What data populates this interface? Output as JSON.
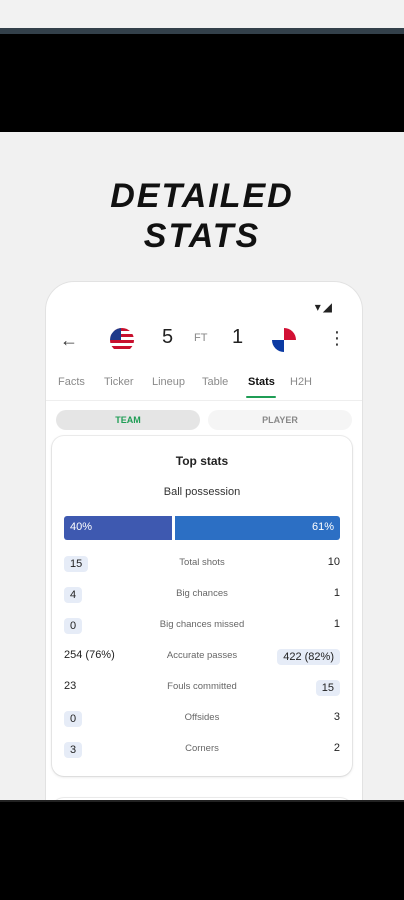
{
  "poster": {
    "headline_line1": "DETAILED",
    "headline_line2": "STATS"
  },
  "statusbar": {
    "wifi_icon": "wifi-icon",
    "signal_icon": "signal-icon"
  },
  "match": {
    "home_score": "5",
    "status": "FT",
    "away_score": "1"
  },
  "tabs": [
    "Facts",
    "Ticker",
    "Lineup",
    "Table",
    "Stats",
    "H2H"
  ],
  "active_tab": "Stats",
  "toggle": {
    "team": "TEAM",
    "player": "PLAYER"
  },
  "top_stats": {
    "title": "Top stats",
    "possession_label": "Ball possession",
    "possession_home": "40%",
    "possession_away": "61%",
    "rows": [
      {
        "left": "15",
        "label": "Total shots",
        "right": "10"
      },
      {
        "left": "4",
        "label": "Big chances",
        "right": "1"
      },
      {
        "left": "0",
        "label": "Big chances missed",
        "right": "1"
      },
      {
        "left": "254 (76%)",
        "label": "Accurate passes",
        "right": "422 (82%)"
      },
      {
        "left": "23",
        "label": "Fouls committed",
        "right": "15"
      },
      {
        "left": "0",
        "label": "Offsides",
        "right": "3"
      },
      {
        "left": "3",
        "label": "Corners",
        "right": "2"
      }
    ]
  },
  "colors": {
    "accent_green": "#1f9d55",
    "home_blue": "#3e59b0",
    "away_blue": "#2c6fc4"
  }
}
